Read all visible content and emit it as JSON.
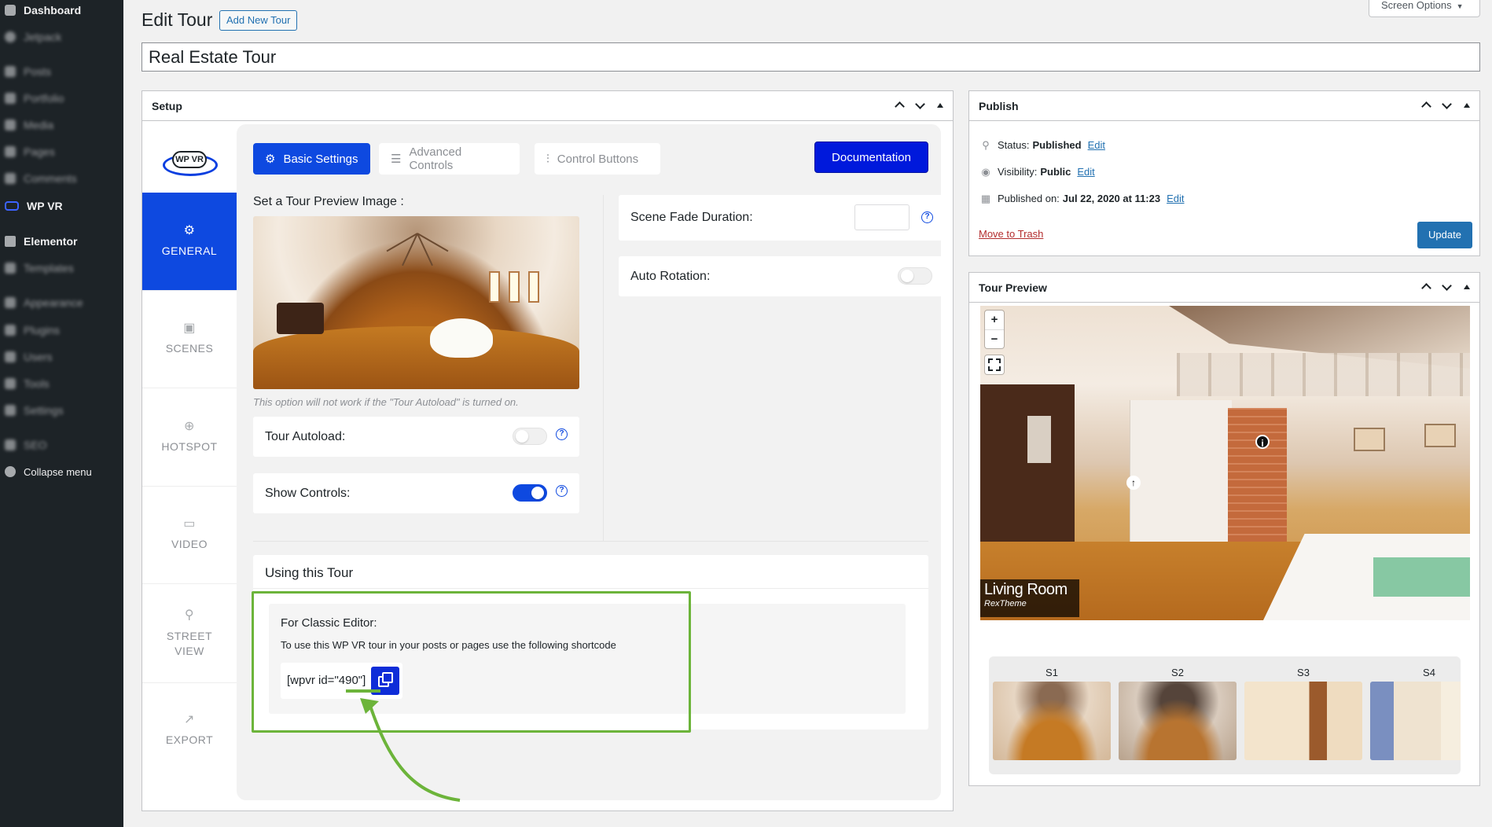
{
  "sidebar": {
    "items": [
      {
        "label": "Dashboard"
      },
      {
        "label": "Jetpack"
      },
      {
        "label": "Posts"
      },
      {
        "label": "Portfolio"
      },
      {
        "label": "Media"
      },
      {
        "label": "Pages"
      },
      {
        "label": "Comments"
      },
      {
        "label": "WP VR"
      },
      {
        "label": "Elementor"
      },
      {
        "label": "Templates"
      },
      {
        "label": "Appearance"
      },
      {
        "label": "Plugins"
      },
      {
        "label": "Users"
      },
      {
        "label": "Tools"
      },
      {
        "label": "Settings"
      },
      {
        "label": "SEO"
      },
      {
        "label": "Collapse menu"
      }
    ]
  },
  "header": {
    "title": "Edit Tour",
    "add_new": "Add New Tour",
    "screen_options": "Screen Options",
    "tour_title": "Real Estate Tour"
  },
  "setup": {
    "heading": "Setup",
    "logo_text": "WP VR",
    "nav": [
      {
        "label": "GENERAL"
      },
      {
        "label": "SCENES"
      },
      {
        "label": "HOTSPOT"
      },
      {
        "label": "VIDEO"
      },
      {
        "label": "STREET VIEW"
      },
      {
        "label": "EXPORT"
      }
    ],
    "tabs": {
      "basic": "Basic Settings",
      "advanced": "Advanced Controls",
      "control": "Control Buttons"
    },
    "documentation": "Documentation",
    "preview_label": "Set a Tour Preview Image :",
    "preview_note": "This option will not work if the \"Tour Autoload\" is turned on.",
    "tour_autoload": {
      "label": "Tour Autoload:",
      "on": false
    },
    "show_controls": {
      "label": "Show Controls:",
      "on": true
    },
    "scene_fade": {
      "label": "Scene Fade Duration:",
      "value": ""
    },
    "auto_rotation": {
      "label": "Auto Rotation:",
      "on": false
    },
    "help_glyph": "?",
    "using": {
      "title": "Using this Tour",
      "classic_title": "For Classic Editor:",
      "classic_desc": "To use this WP VR tour in your posts or pages use the following shortcode",
      "shortcode": "[wpvr id=\"490\"]"
    }
  },
  "publish": {
    "heading": "Publish",
    "status_label": "Status:",
    "status_value": "Published",
    "visibility_label": "Visibility:",
    "visibility_value": "Public",
    "published_label": "Published on:",
    "published_value": "Jul 22, 2020 at 11:23",
    "edit": "Edit",
    "move_to_trash": "Move to Trash",
    "update": "Update"
  },
  "tour_preview": {
    "heading": "Tour Preview",
    "zoom_in": "+",
    "zoom_out": "−",
    "scene_title": "Living Room",
    "scene_sub": "RexTheme",
    "scenes": [
      {
        "label": "S1"
      },
      {
        "label": "S2"
      },
      {
        "label": "S3"
      },
      {
        "label": "S4"
      }
    ]
  },
  "colors": {
    "accent_blue": "#0e49e0",
    "doc_blue": "#0019dc",
    "highlight_green": "#6cb43a",
    "wp_blue": "#2271b1",
    "sidebar_bg": "#1d2327"
  }
}
